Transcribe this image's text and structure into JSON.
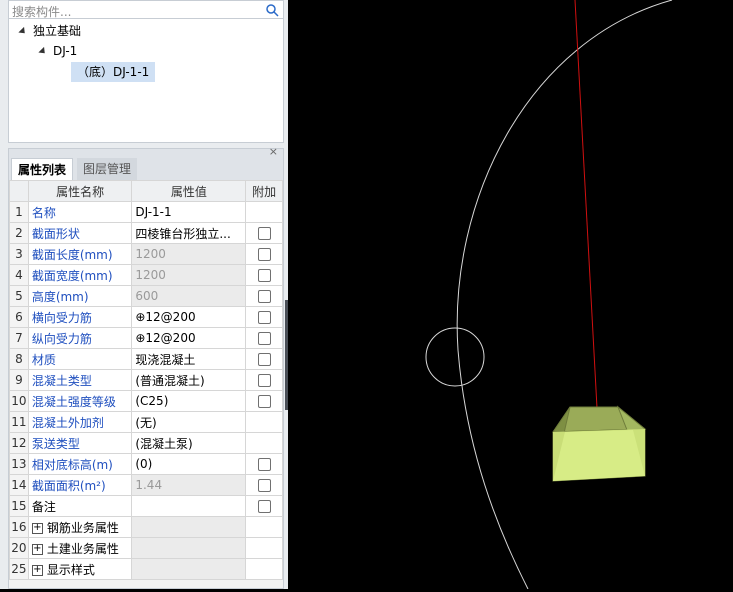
{
  "search": {
    "placeholder": "搜索构件..."
  },
  "tree": {
    "root": "独立基础",
    "child": "DJ-1",
    "leaf": "（底）DJ-1-1"
  },
  "panel": {
    "tabs": [
      "属性列表",
      "图层管理"
    ],
    "headers": [
      "属性名称",
      "属性值",
      "附加"
    ]
  },
  "rows": [
    {
      "n": "1",
      "name": "名称",
      "value": "DJ-1-1"
    },
    {
      "n": "2",
      "name": "截面形状",
      "value": "四棱锥台形独立..."
    },
    {
      "n": "3",
      "name": "截面长度(mm)",
      "value": "1200"
    },
    {
      "n": "4",
      "name": "截面宽度(mm)",
      "value": "1200"
    },
    {
      "n": "5",
      "name": "高度(mm)",
      "value": "600"
    },
    {
      "n": "6",
      "name": "横向受力筋",
      "value": "⊕12@200"
    },
    {
      "n": "7",
      "name": "纵向受力筋",
      "value": "⊕12@200"
    },
    {
      "n": "8",
      "name": "材质",
      "value": "现浇混凝土"
    },
    {
      "n": "9",
      "name": "混凝土类型",
      "value": "(普通混凝土)"
    },
    {
      "n": "10",
      "name": "混凝土强度等级",
      "value": "(C25)"
    },
    {
      "n": "11",
      "name": "混凝土外加剂",
      "value": "(无)"
    },
    {
      "n": "12",
      "name": "泵送类型",
      "value": "(混凝土泵)"
    },
    {
      "n": "13",
      "name": "相对底标高(m)",
      "value": "(0)"
    },
    {
      "n": "14",
      "name": "截面面积(m²)",
      "value": "1.44"
    },
    {
      "n": "15",
      "name": "备注",
      "value": ""
    },
    {
      "n": "16",
      "name": "钢筋业务属性",
      "value": ""
    },
    {
      "n": "20",
      "name": "土建业务属性",
      "value": ""
    },
    {
      "n": "25",
      "name": "显示样式",
      "value": ""
    }
  ],
  "colors": {
    "label_blue": "#1f4fbf",
    "viewport_bg": "#000000",
    "axis_red": "#d01010",
    "shape_fill": "#b5d26a"
  }
}
